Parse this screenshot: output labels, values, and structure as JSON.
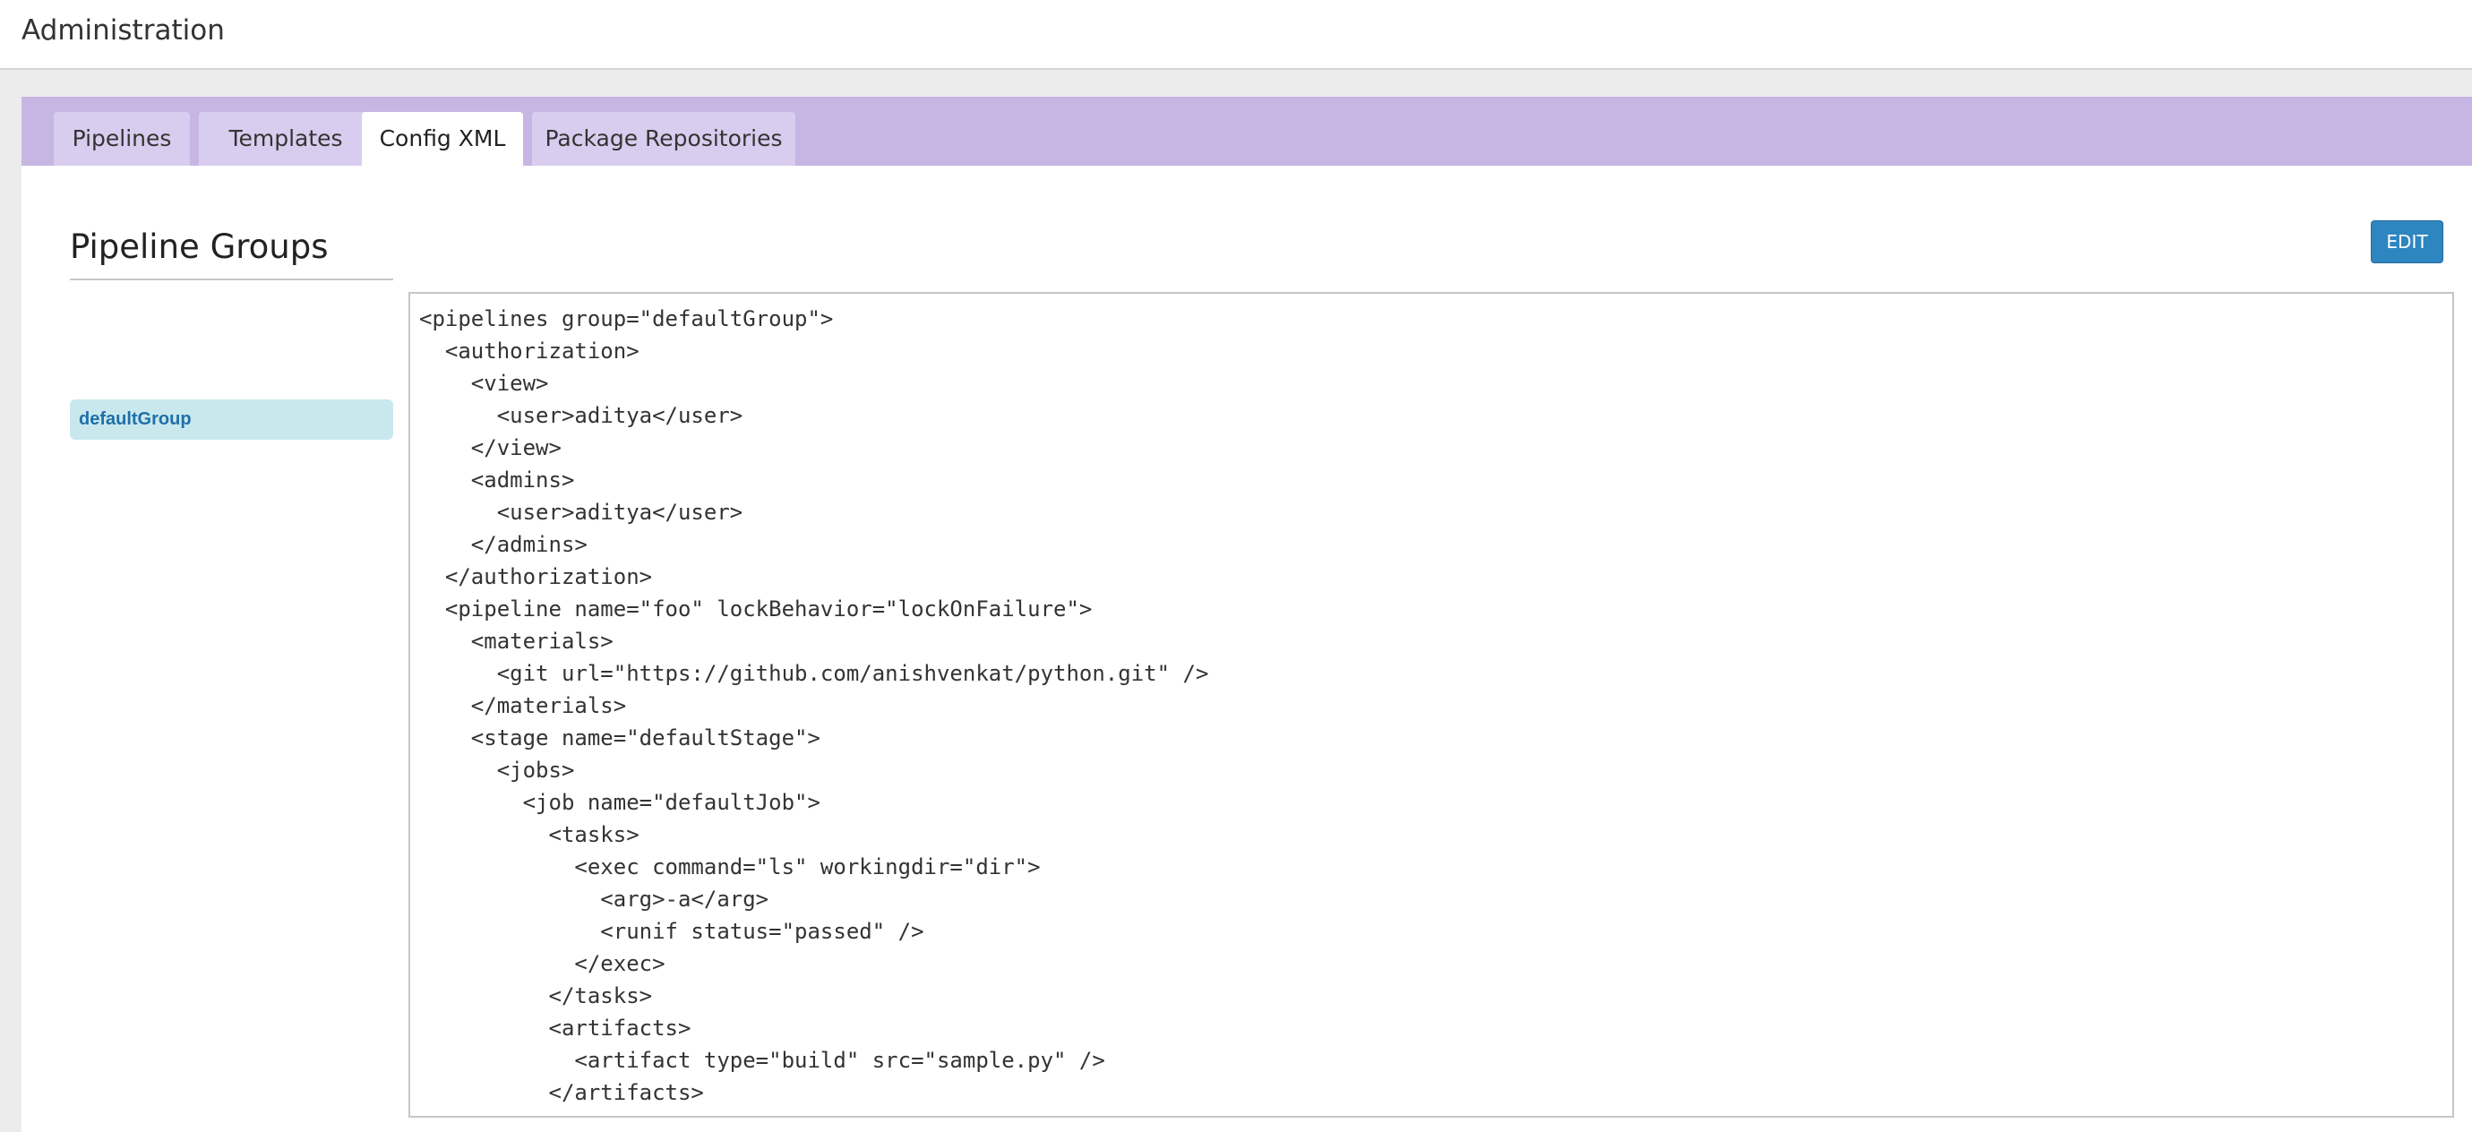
{
  "header": {
    "title": "Administration"
  },
  "tabs": [
    {
      "label": "Pipelines",
      "active": false
    },
    {
      "label": "Templates",
      "active": false
    },
    {
      "label": "Config XML",
      "active": true
    },
    {
      "label": "Package Repositories",
      "active": false
    }
  ],
  "main": {
    "section_title": "Pipeline Groups",
    "edit_label": "EDIT",
    "groups": [
      "defaultGroup"
    ],
    "xml_lines": [
      "<pipelines group=\"defaultGroup\">",
      "  <authorization>",
      "    <view>",
      "      <user>aditya</user>",
      "    </view>",
      "    <admins>",
      "      <user>aditya</user>",
      "    </admins>",
      "  </authorization>",
      "  <pipeline name=\"foo\" lockBehavior=\"lockOnFailure\">",
      "    <materials>",
      "      <git url=\"https://github.com/anishvenkat/python.git\" />",
      "    </materials>",
      "    <stage name=\"defaultStage\">",
      "      <jobs>",
      "        <job name=\"defaultJob\">",
      "          <tasks>",
      "            <exec command=\"ls\" workingdir=\"dir\">",
      "              <arg>-a</arg>",
      "              <runif status=\"passed\" />",
      "            </exec>",
      "          </tasks>",
      "          <artifacts>",
      "            <artifact type=\"build\" src=\"sample.py\" />",
      "          </artifacts>"
    ]
  },
  "colors": {
    "tab_band": "#c7b6e3",
    "tab_inactive": "#d8cdee",
    "edit_button": "#2e86c1",
    "selected_group": "#c9e8ee"
  }
}
